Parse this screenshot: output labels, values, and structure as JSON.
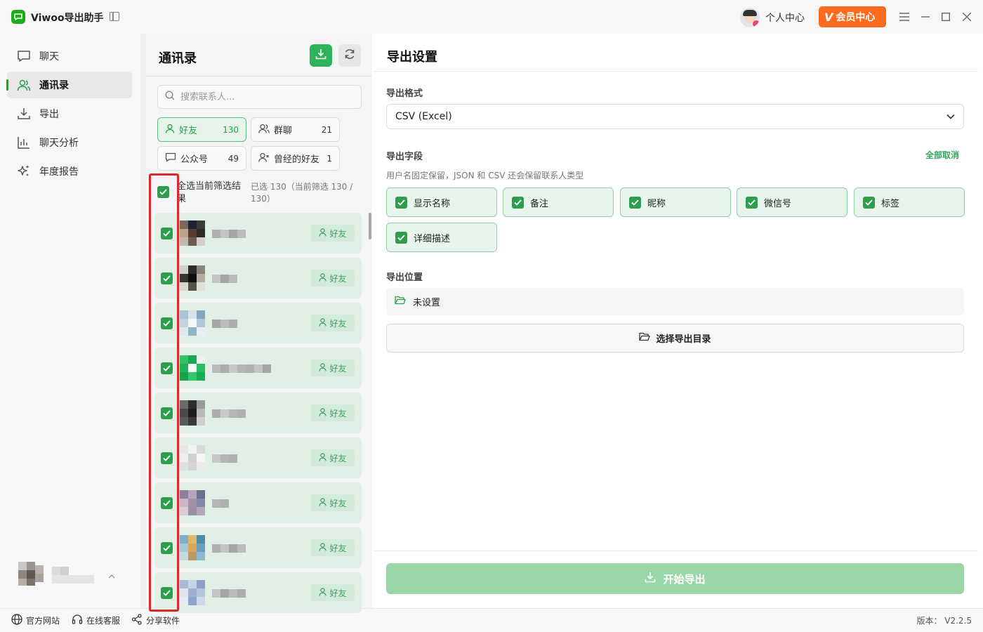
{
  "app": {
    "title": "Viwoo导出助手"
  },
  "topbar": {
    "personal_center": "个人中心",
    "vip_center": "会员中心",
    "vip_badge": "V"
  },
  "sidebar": {
    "items": [
      {
        "label": "聊天",
        "icon": "chat-icon"
      },
      {
        "label": "通讯录",
        "icon": "contacts-icon",
        "active": true
      },
      {
        "label": "导出",
        "icon": "download-icon"
      },
      {
        "label": "聊天分析",
        "icon": "bar-chart-icon"
      },
      {
        "label": "年度报告",
        "icon": "sparkle-icon"
      }
    ]
  },
  "footer": {
    "website": "官方网站",
    "support": "在线客服",
    "share": "分享软件",
    "version": "版本： V2.2.5"
  },
  "contacts": {
    "title": "通讯录",
    "search_placeholder": "搜索联系人...",
    "filters": [
      {
        "label": "好友",
        "count": "130",
        "active": true
      },
      {
        "label": "群聊",
        "count": "21"
      },
      {
        "label": "公众号",
        "count": "49"
      },
      {
        "label": "曾经的好友",
        "count": "1"
      }
    ],
    "select_all_label": "全选当前筛选结果",
    "selection_status": "已选 130（当前筛选 130 / 130）",
    "row_tag": "好友",
    "row_count_visible": 9
  },
  "export": {
    "title": "导出设置",
    "format_label": "导出格式",
    "format_value": "CSV (Excel)",
    "fields_label": "导出字段",
    "cancel_all": "全部取消",
    "fields_hint": "用户名固定保留，JSON 和 CSV 还会保留联系人类型",
    "fields": [
      "显示名称",
      "备注",
      "昵称",
      "微信号",
      "标签",
      "详细描述"
    ],
    "location_label": "导出位置",
    "location_value": "未设置",
    "choose_dir": "选择导出目录",
    "start": "开始导出"
  },
  "colors": {
    "brand_green": "#2fb35a",
    "vip_orange": "#ff6a1f",
    "highlight_red": "#e0262d"
  }
}
